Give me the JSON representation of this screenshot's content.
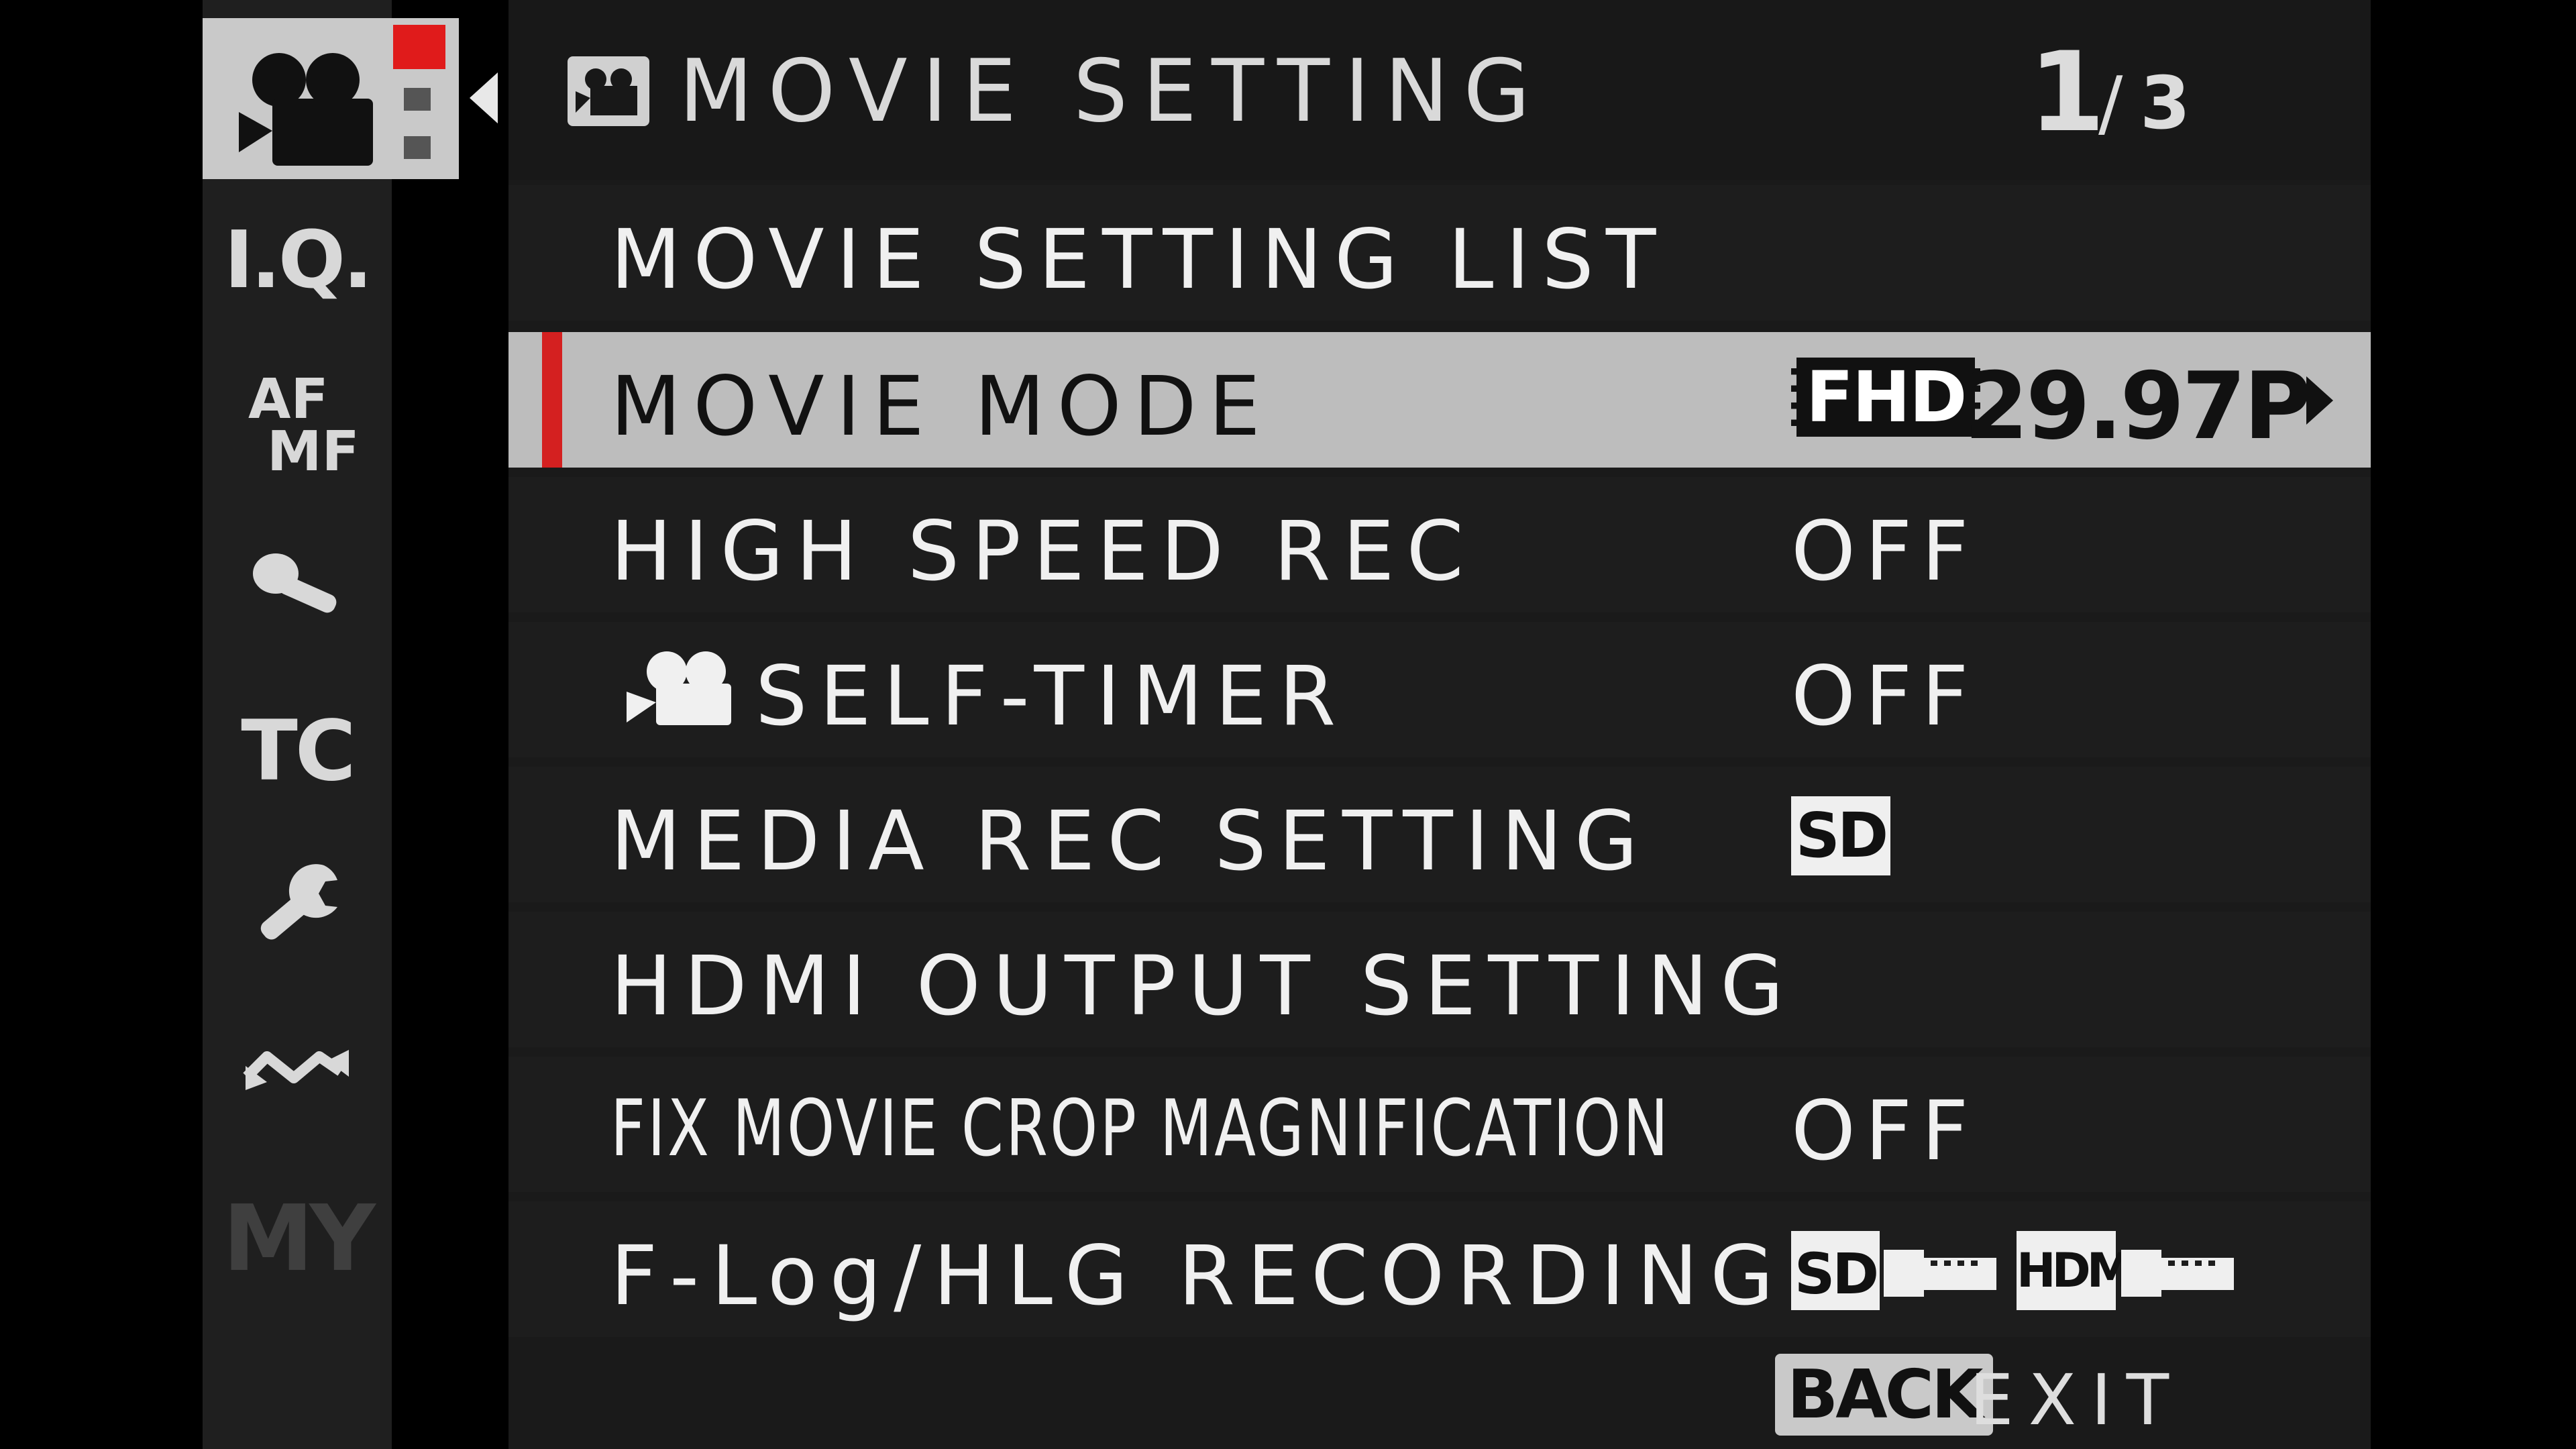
{
  "sidebar": {
    "items": [
      {
        "name": "movie-setting",
        "icon": "movie-camera-icon",
        "selected": true
      },
      {
        "name": "image-quality",
        "label": "I.Q."
      },
      {
        "name": "focus",
        "label_top": "AF",
        "label_bottom": "MF"
      },
      {
        "name": "audio",
        "icon": "microphone-icon"
      },
      {
        "name": "timecode",
        "label": "TC"
      },
      {
        "name": "setup",
        "icon": "wrench-icon"
      },
      {
        "name": "connection",
        "icon": "wave-arrow-icon"
      },
      {
        "name": "my-menu",
        "label": "MY",
        "disabled": true
      }
    ],
    "accent_color": "#e01b1b"
  },
  "header": {
    "title": "MOVIE SETTING",
    "page_current": "1",
    "page_separator": "/",
    "page_total": "3"
  },
  "menu": {
    "items": [
      {
        "label": "MOVIE SETTING LIST",
        "value": ""
      },
      {
        "label": "MOVIE MODE",
        "value_badge": "FHD",
        "value": "29.97P",
        "selected": true
      },
      {
        "label": "HIGH SPEED REC",
        "value": "OFF"
      },
      {
        "label": "SELF-TIMER",
        "value": "OFF",
        "icon": "movie-camera-icon"
      },
      {
        "label": "MEDIA REC SETTING",
        "value_badge": "SD"
      },
      {
        "label": "HDMI OUTPUT SETTING",
        "value": ""
      },
      {
        "label": "FIX MOVIE CROP MAGNIFICATION",
        "value": "OFF"
      },
      {
        "label": "F-Log/HLG RECORDING",
        "value_badges": [
          "SD",
          "HDMI"
        ]
      }
    ]
  },
  "footer": {
    "back_label": "BACK",
    "exit_label": "EXIT"
  },
  "colors": {
    "selected_row": "#bdbdbd",
    "selection_bar": "#d42020",
    "background": "#1a1a1a"
  }
}
